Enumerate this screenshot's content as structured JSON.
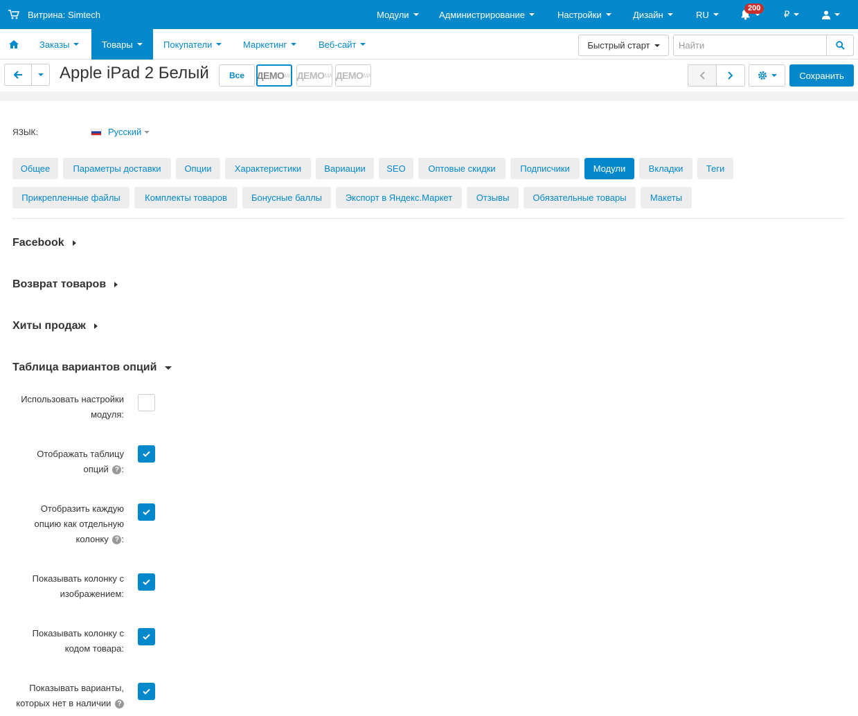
{
  "topbar": {
    "store_label": "Витрина: Simtech",
    "menus": [
      "Модули",
      "Администрирование",
      "Настройки",
      "Дизайн",
      "RU"
    ],
    "notifications_count": "200",
    "currency": "₽"
  },
  "nav": {
    "items": [
      "Заказы",
      "Товары",
      "Покупатели",
      "Маркетинг",
      "Веб-сайт"
    ],
    "quick_start": "Быстрый старт",
    "search_placeholder": "Найти"
  },
  "toolbar": {
    "title": "Apple iPad 2 Белый",
    "all_label": "Все",
    "demo_label": "ДЕМО",
    "demo_sup": "МА",
    "save_label": "Сохранить"
  },
  "language": {
    "label": "ЯЗЫК:",
    "value": "Русский"
  },
  "tabs_row1": [
    "Общее",
    "Параметры доставки",
    "Опции",
    "Характеристики",
    "Вариации",
    "SEO",
    "Оптовые скидки",
    "Подписчики",
    "Модули",
    "Вкладки",
    "Теги"
  ],
  "tabs_row2": [
    "Прикрепленные файлы",
    "Комплекты товаров",
    "Бонусные баллы",
    "Экспорт в Яндекс.Маркет",
    "Отзывы",
    "Обязательные товары",
    "Макеты"
  ],
  "active_tab": "Модули",
  "sections": [
    "Facebook",
    "Возврат товаров",
    "Хиты продаж",
    "Таблица вариантов опций"
  ],
  "fields": [
    {
      "l1": "Использовать настройки",
      "l2": "модуля:",
      "help": false,
      "checked": false
    },
    {
      "l1": "Отображать таблицу",
      "l2": "опций",
      "help": true,
      "checked": true
    },
    {
      "l1": "Отобразить каждую",
      "l2": "опцию как отдельную",
      "l3": "колонку",
      "help": true,
      "checked": true
    },
    {
      "l1": "Показывать колонку с",
      "l2": "изображением:",
      "help": false,
      "checked": true
    },
    {
      "l1": "Показывать колонку с",
      "l2": "кодом товара:",
      "help": false,
      "checked": true
    },
    {
      "l1": "Показывать варианты,",
      "l2": "которых нет в наличии",
      "help": true,
      "checked": true
    }
  ],
  "colors": {
    "primary": "#0388cc",
    "tab_bg": "#ededed"
  }
}
